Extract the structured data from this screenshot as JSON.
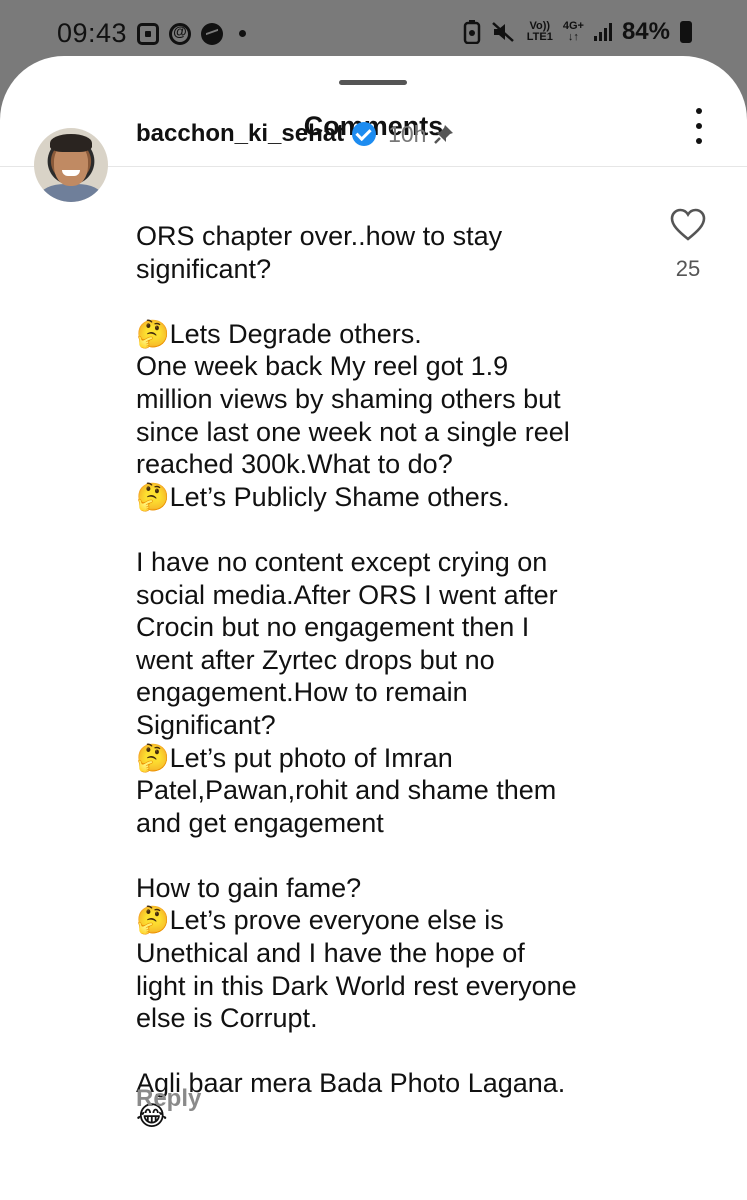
{
  "status_bar": {
    "time": "09:43",
    "network_top": "Vo))",
    "network_bottom": "LTE1",
    "data_top": "4G+",
    "data_bottom": "↓↑",
    "battery": "84%"
  },
  "header": {
    "title": "Comments"
  },
  "comment": {
    "username": "bacchon_ki_sehat",
    "time": "10h",
    "likes": "25",
    "text": "ORS chapter over..how to stay\nsignificant?\n\n🤔Lets Degrade others.\nOne week back My reel got 1.9\nmillion views by shaming others but\nsince last one week not a single reel\nreached 300k.What to do?\n🤔Let’s Publicly Shame others.\n\nI have no content except crying on\nsocial media.After ORS I went after\nCrocin but no engagement then I\nwent after Zyrtec drops but no\nengagement.How to remain\nSignificant?\n🤔Let’s put photo of Imran\nPatel,Pawan,rohit and shame them\nand get engagement\n\nHow to gain fame?\n🤔Let’s prove everyone else is\nUnethical and I have the hope of\nlight in this Dark World rest everyone\nelse is Corrupt.\n\nAgli baar mera Bada Photo Lagana.\n😂",
    "reply_label": "Reply"
  }
}
